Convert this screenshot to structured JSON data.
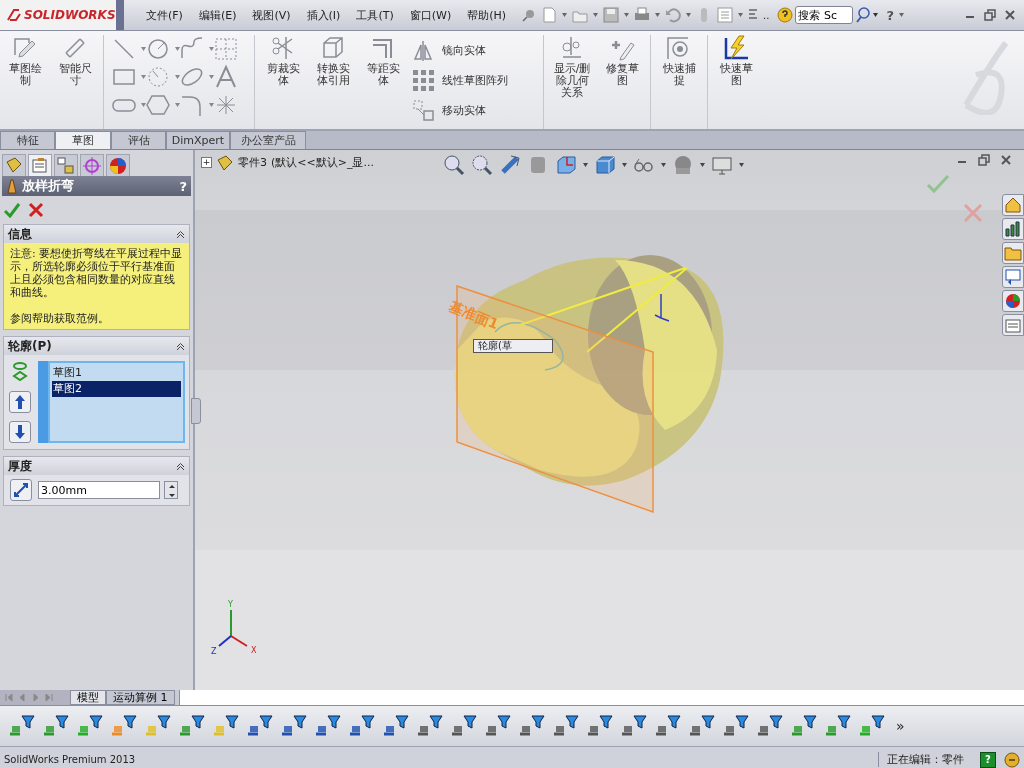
{
  "app": {
    "logo": "SOLIDWORKS"
  },
  "menu": [
    {
      "label": "文件(F)"
    },
    {
      "label": "编辑(E)"
    },
    {
      "label": "视图(V)"
    },
    {
      "label": "插入(I)"
    },
    {
      "label": "工具(T)"
    },
    {
      "label": "窗口(W)"
    },
    {
      "label": "帮助(H)"
    }
  ],
  "quick_access": {
    "more": "..",
    "search_value": "搜索 Sc",
    "help": "?"
  },
  "ribbon": [
    {
      "label": "草图绘制",
      "kind": "large",
      "disabled": true
    },
    {
      "label": "智能尺寸",
      "kind": "large",
      "disabled": true
    },
    {
      "kind": "sketch_tools",
      "disabled": true
    },
    {
      "label": "剪裁实体",
      "kind": "large",
      "disabled": true
    },
    {
      "label": "转换实体引用",
      "kind": "large",
      "disabled": true
    },
    {
      "label": "等距实体",
      "kind": "large",
      "disabled": true
    },
    {
      "kind": "stack",
      "disabled": true,
      "items": [
        "镜向实体",
        "线性草图阵列",
        "移动实体"
      ]
    },
    {
      "label": "显示/删除几何关系",
      "kind": "large",
      "disabled": true
    },
    {
      "label": "修复草图",
      "kind": "large",
      "disabled": true
    },
    {
      "label": "快速捕捉",
      "kind": "large",
      "disabled": true
    },
    {
      "label": "快速草图",
      "kind": "large",
      "disabled": false
    }
  ],
  "tabs": [
    {
      "label": "特征",
      "selected": false
    },
    {
      "label": "草图",
      "selected": true
    },
    {
      "label": "评估",
      "selected": false
    },
    {
      "label": "DimXpert",
      "selected": false
    },
    {
      "label": "办公室产品",
      "selected": false
    }
  ],
  "manager_tabs": [
    {
      "selected": false
    },
    {
      "selected": true
    },
    {
      "selected": false
    },
    {
      "selected": false
    },
    {
      "selected": false
    }
  ],
  "feature_tree": {
    "expand": "+",
    "part": "零件3",
    "config": "(默认<<默认>_显..."
  },
  "property_manager": {
    "title": "放样折弯",
    "help": "?",
    "sections": [
      {
        "kind": "message",
        "title": "信息",
        "paragraphs": [
          "注意: 要想使折弯线在平展过程中显示，所选轮廓必须位于平行基准面上且必须包含相同数量的对应直线和曲线。",
          "参阅帮助获取范例。"
        ]
      },
      {
        "kind": "list",
        "title": "轮廓(P)",
        "items": [
          {
            "label": "草图1",
            "selected": false
          },
          {
            "label": "草图2",
            "selected": true
          }
        ]
      },
      {
        "kind": "number",
        "title": "厚度",
        "value": "3.00mm"
      }
    ]
  },
  "viewport": {
    "plane_label": "基准面1",
    "tooltip": "轮廓(草",
    "triad": [
      "Y",
      "Z",
      "X"
    ]
  },
  "bottom_tabs": [
    {
      "label": "模型",
      "selected": true
    },
    {
      "label": "运动算例 1",
      "selected": false
    }
  ],
  "filter_toolbar": {
    "more": "»"
  },
  "status_bar": {
    "app": "SolidWorks Premium 2013",
    "editing": "正在编辑：零件",
    "help": "?"
  }
}
